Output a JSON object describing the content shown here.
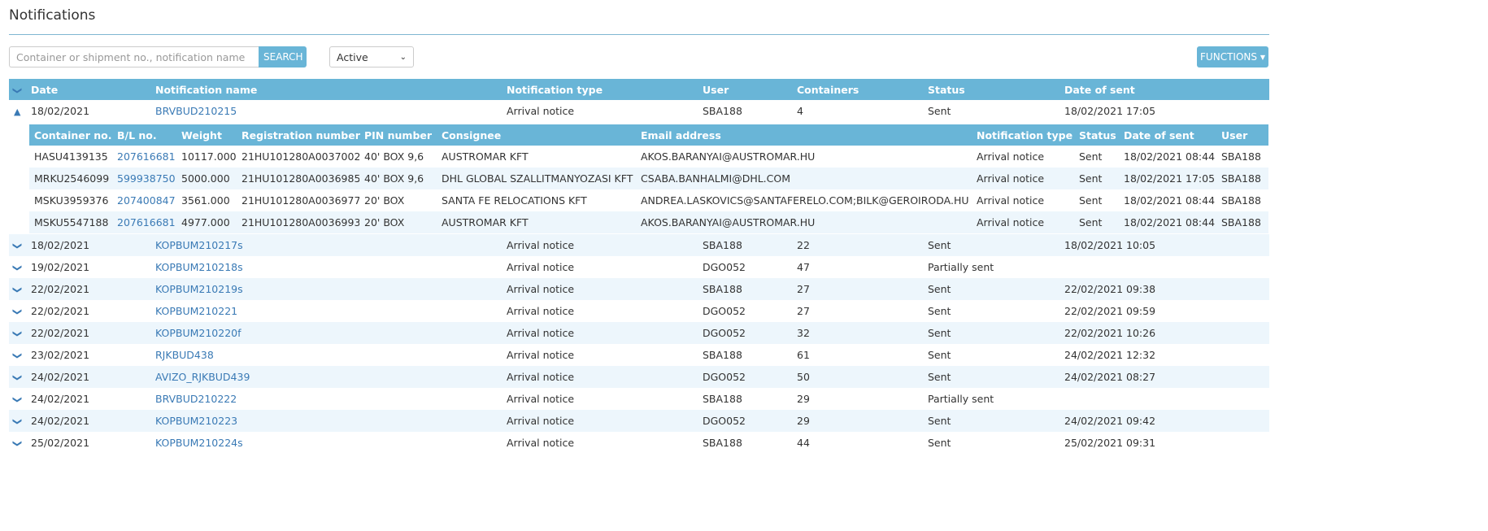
{
  "page": {
    "title": "Notifications"
  },
  "toolbar": {
    "search_placeholder": "Container or shipment no., notification name",
    "search_label": "SEARCH",
    "filter_value": "Active",
    "functions_label": "FUNCTIONS"
  },
  "main_columns": [
    "Date",
    "Notification name",
    "Notification type",
    "User",
    "Containers",
    "Status",
    "Date of sent"
  ],
  "sub_columns": [
    "Container no.",
    "B/L no.",
    "Weight",
    "Registration number",
    "PIN number",
    "Consignee",
    "Email address",
    "Notification type",
    "Status",
    "Date of sent",
    "User"
  ],
  "expanded": {
    "date": "18/02/2021",
    "name": "BRVBUD210215",
    "type": "Arrival notice",
    "user": "SBA188",
    "containers": "4",
    "status": "Sent",
    "sent": "18/02/2021 17:05",
    "containers_list": [
      {
        "c": "HASU4139135",
        "bl": "207616681",
        "w": "10117.000",
        "reg": "21HU101280A0037002",
        "pin": "40' BOX 9,6",
        "cons": "AUSTROMAR KFT",
        "email": "AKOS.BARANYAI@AUSTROMAR.HU",
        "type": "Arrival notice",
        "status": "Sent",
        "sent": "18/02/2021 08:44",
        "user": "SBA188"
      },
      {
        "c": "MRKU2546099",
        "bl": "599938750",
        "w": "5000.000",
        "reg": "21HU101280A0036985",
        "pin": "40' BOX 9,6",
        "cons": "DHL GLOBAL SZALLITMANYOZASI KFT",
        "email": "CSABA.BANHALMI@DHL.COM",
        "type": "Arrival notice",
        "status": "Sent",
        "sent": "18/02/2021 17:05",
        "user": "SBA188"
      },
      {
        "c": "MSKU3959376",
        "bl": "207400847",
        "w": "3561.000",
        "reg": "21HU101280A0036977",
        "pin": "20' BOX",
        "cons": "SANTA FE RELOCATIONS KFT",
        "email": "ANDREA.LASKOVICS@SANTAFERELO.COM;BILK@GEROIRODA.HU",
        "type": "Arrival notice",
        "status": "Sent",
        "sent": "18/02/2021 08:44",
        "user": "SBA188"
      },
      {
        "c": "MSKU5547188",
        "bl": "207616681",
        "w": "4977.000",
        "reg": "21HU101280A0036993",
        "pin": "20' BOX",
        "cons": "AUSTROMAR KFT",
        "email": "AKOS.BARANYAI@AUSTROMAR.HU",
        "type": "Arrival notice",
        "status": "Sent",
        "sent": "18/02/2021 08:44",
        "user": "SBA188"
      }
    ]
  },
  "rows": [
    {
      "date": "18/02/2021",
      "name": "KOPBUM210217s",
      "type": "Arrival notice",
      "user": "SBA188",
      "containers": "22",
      "status": "Sent",
      "sent": "18/02/2021 10:05"
    },
    {
      "date": "19/02/2021",
      "name": "KOPBUM210218s",
      "type": "Arrival notice",
      "user": "DGO052",
      "containers": "47",
      "status": "Partially sent",
      "sent": ""
    },
    {
      "date": "22/02/2021",
      "name": "KOPBUM210219s",
      "type": "Arrival notice",
      "user": "SBA188",
      "containers": "27",
      "status": "Sent",
      "sent": "22/02/2021 09:38"
    },
    {
      "date": "22/02/2021",
      "name": "KOPBUM210221",
      "type": "Arrival notice",
      "user": "DGO052",
      "containers": "27",
      "status": "Sent",
      "sent": "22/02/2021 09:59"
    },
    {
      "date": "22/02/2021",
      "name": "KOPBUM210220f",
      "type": "Arrival notice",
      "user": "DGO052",
      "containers": "32",
      "status": "Sent",
      "sent": "22/02/2021 10:26"
    },
    {
      "date": "23/02/2021",
      "name": "RJKBUD438",
      "type": "Arrival notice",
      "user": "SBA188",
      "containers": "61",
      "status": "Sent",
      "sent": "24/02/2021 12:32"
    },
    {
      "date": "24/02/2021",
      "name": "AVIZO_RJKBUD439",
      "type": "Arrival notice",
      "user": "DGO052",
      "containers": "50",
      "status": "Sent",
      "sent": "24/02/2021 08:27"
    },
    {
      "date": "24/02/2021",
      "name": "BRVBUD210222",
      "type": "Arrival notice",
      "user": "SBA188",
      "containers": "29",
      "status": "Partially sent",
      "sent": ""
    },
    {
      "date": "24/02/2021",
      "name": "KOPBUM210223",
      "type": "Arrival notice",
      "user": "DGO052",
      "containers": "29",
      "status": "Sent",
      "sent": "24/02/2021 09:42"
    },
    {
      "date": "25/02/2021",
      "name": "KOPBUM210224s",
      "type": "Arrival notice",
      "user": "SBA188",
      "containers": "44",
      "status": "Sent",
      "sent": "25/02/2021 09:31"
    }
  ],
  "colors": {
    "accent": "#69b5d7",
    "link": "#3a7ab5",
    "stripe": "#edf6fc"
  }
}
